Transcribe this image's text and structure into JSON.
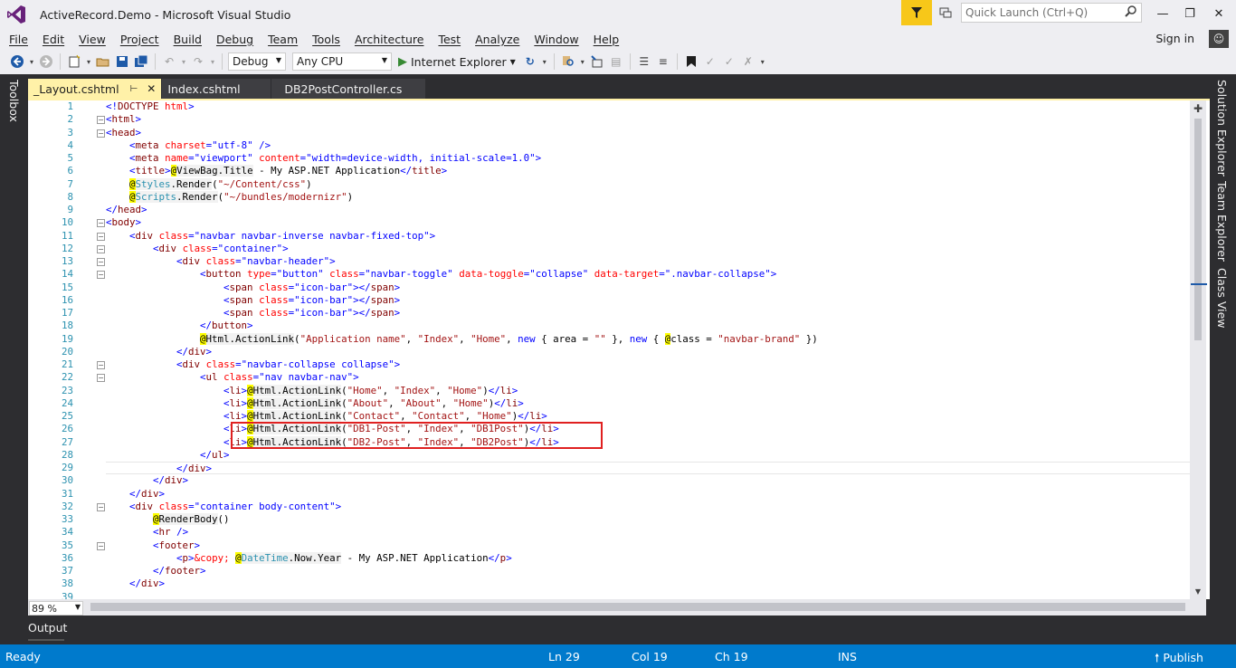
{
  "window": {
    "title": "ActiveRecord.Demo - Microsoft Visual Studio",
    "quick_launch_placeholder": "Quick Launch (Ctrl+Q)",
    "sign_in": "Sign in"
  },
  "menu": [
    "File",
    "Edit",
    "View",
    "Project",
    "Build",
    "Debug",
    "Team",
    "Tools",
    "Architecture",
    "Test",
    "Analyze",
    "Window",
    "Help"
  ],
  "toolbar": {
    "config": "Debug",
    "platform": "Any CPU",
    "run_target": "Internet Explorer"
  },
  "side_tools": {
    "left": [
      "Toolbox"
    ],
    "right": [
      "Solution Explorer",
      "Team Explorer",
      "Class View"
    ]
  },
  "tabs": [
    {
      "label": "_Layout.cshtml",
      "active": true
    },
    {
      "label": "Index.cshtml",
      "active": false
    },
    {
      "label": "DB2PostController.cs",
      "active": false
    }
  ],
  "editor": {
    "zoom": "89 %",
    "current_line": 29,
    "highlighted_lines": [
      26,
      27
    ],
    "lines": [
      "<!DOCTYPE html>",
      "<html>",
      "<head>",
      "    <meta charset=\"utf-8\" />",
      "    <meta name=\"viewport\" content=\"width=device-width, initial-scale=1.0\">",
      "    <title>@ViewBag.Title - My ASP.NET Application</title>",
      "    @Styles.Render(\"~/Content/css\")",
      "    @Scripts.Render(\"~/bundles/modernizr\")",
      "</head>",
      "<body>",
      "    <div class=\"navbar navbar-inverse navbar-fixed-top\">",
      "        <div class=\"container\">",
      "            <div class=\"navbar-header\">",
      "                <button type=\"button\" class=\"navbar-toggle\" data-toggle=\"collapse\" data-target=\".navbar-collapse\">",
      "                    <span class=\"icon-bar\"></span>",
      "                    <span class=\"icon-bar\"></span>",
      "                    <span class=\"icon-bar\"></span>",
      "                </button>",
      "                @Html.ActionLink(\"Application name\", \"Index\", \"Home\", new { area = \"\" }, new { @class = \"navbar-brand\" })",
      "            </div>",
      "            <div class=\"navbar-collapse collapse\">",
      "                <ul class=\"nav navbar-nav\">",
      "                    <li>@Html.ActionLink(\"Home\", \"Index\", \"Home\")</li>",
      "                    <li>@Html.ActionLink(\"About\", \"About\", \"Home\")</li>",
      "                    <li>@Html.ActionLink(\"Contact\", \"Contact\", \"Home\")</li>",
      "                    <li>@Html.ActionLink(\"DB1-Post\", \"Index\", \"DB1Post\")</li>",
      "                    <li>@Html.ActionLink(\"DB2-Post\", \"Index\", \"DB2Post\")</li>",
      "                </ul>",
      "            </div>",
      "        </div>",
      "    </div>",
      "    <div class=\"container body-content\">",
      "        @RenderBody()",
      "        <hr />",
      "        <footer>",
      "            <p>&copy; @DateTime.Now.Year - My ASP.NET Application</p>",
      "        </footer>",
      "    </div>",
      ""
    ]
  },
  "output_tab": "Output",
  "status": {
    "state": "Ready",
    "ln": "Ln 29",
    "col": "Col 19",
    "ch": "Ch 19",
    "mode": "INS",
    "publish": "Publish",
    "bar_color": "#007acc"
  }
}
